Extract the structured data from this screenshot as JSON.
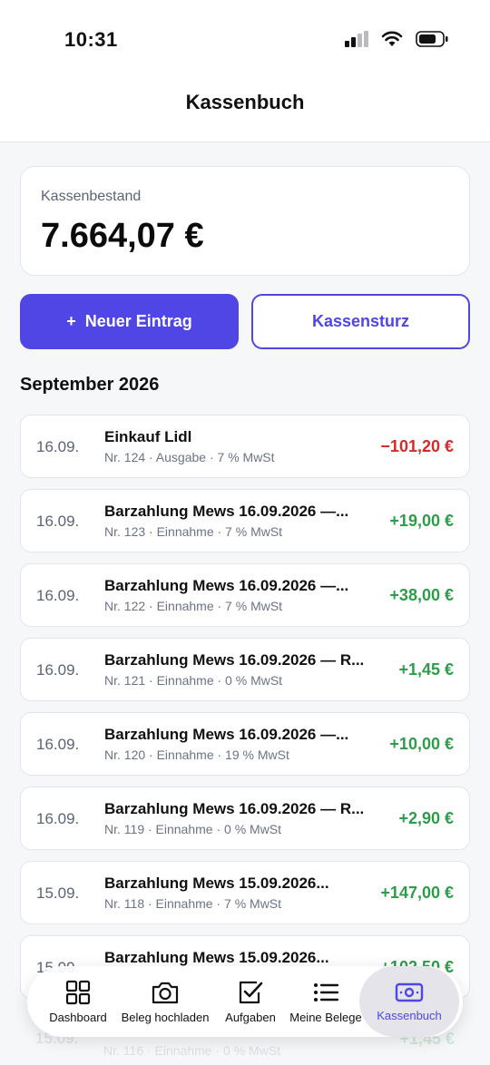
{
  "status": {
    "time": "10:31"
  },
  "header": {
    "title": "Kassenbuch"
  },
  "balance": {
    "label": "Kassenbestand",
    "amount": "7.664,07 €"
  },
  "actions": {
    "new_entry": "Neuer Eintrag",
    "new_entry_icon": "+",
    "cash_count": "Kassensturz"
  },
  "month": "September 2026",
  "entries": [
    {
      "date": "16.09.",
      "title": "Einkauf Lidl",
      "meta": "Nr. 124 · Ausgabe · 7 % MwSt",
      "amount": "−101,20 €"
    },
    {
      "date": "16.09.",
      "title": "Barzahlung Mews 16.09.2026 —...",
      "meta": "Nr. 123 · Einnahme · 7 % MwSt",
      "amount": "+19,00 €"
    },
    {
      "date": "16.09.",
      "title": "Barzahlung Mews 16.09.2026 —...",
      "meta": "Nr. 122 · Einnahme · 7 % MwSt",
      "amount": "+38,00 €"
    },
    {
      "date": "16.09.",
      "title": "Barzahlung Mews 16.09.2026 — R...",
      "meta": "Nr. 121 · Einnahme · 0 % MwSt",
      "amount": "+1,45 €"
    },
    {
      "date": "16.09.",
      "title": "Barzahlung Mews 16.09.2026 —...",
      "meta": "Nr. 120 · Einnahme · 19 % MwSt",
      "amount": "+10,00 €"
    },
    {
      "date": "16.09.",
      "title": "Barzahlung Mews 16.09.2026 — R...",
      "meta": "Nr. 119 · Einnahme · 0 % MwSt",
      "amount": "+2,90 €"
    },
    {
      "date": "15.09.",
      "title": "Barzahlung Mews 15.09.2026...",
      "meta": "Nr. 118 · Einnahme · 7 % MwSt",
      "amount": "+147,00 €"
    },
    {
      "date": "15.09.",
      "title": "Barzahlung Mews 15.09.2026...",
      "meta": "",
      "amount": "+102,50 €"
    }
  ],
  "partial_entry": {
    "date": "15.09.",
    "meta": "Nr. 116 · Einnahme · 0 % MwSt",
    "amount": "+1,45 €"
  },
  "tabs": [
    {
      "label": "Dashboard",
      "icon": "grid-icon"
    },
    {
      "label": "Beleg hochladen",
      "icon": "camera-icon"
    },
    {
      "label": "Aufgaben",
      "icon": "checkbox-icon"
    },
    {
      "label": "Meine Belege",
      "icon": "list-icon"
    },
    {
      "label": "Kassenbuch",
      "icon": "cash-icon"
    }
  ],
  "colors": {
    "accent": "#4f46e5",
    "negative": "#d12b2b",
    "positive": "#2e9d49"
  }
}
